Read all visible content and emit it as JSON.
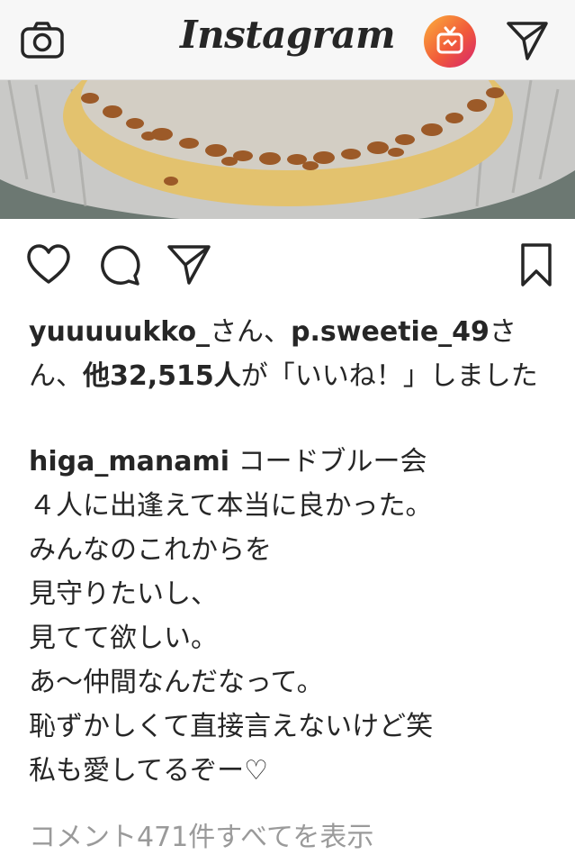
{
  "header": {
    "logo_text": "Instagram",
    "camera_icon": "camera-icon",
    "igtv_icon": "igtv-icon",
    "direct_icon": "paper-plane-icon",
    "igtv_gradient": [
      "#f9a23b",
      "#ee2a7b",
      "#d61e6b"
    ]
  },
  "post": {
    "actions": {
      "like_icon": "heart-icon",
      "comment_icon": "comment-icon",
      "share_icon": "paper-plane-icon",
      "save_icon": "bookmark-icon"
    },
    "likes": {
      "user1": "yuuuuukko_",
      "sep1": "さん、",
      "user2": "p.sweetie_49",
      "sep2": "さん、",
      "others": "他32,515人",
      "suffix": "が「いいね！」しました"
    },
    "caption": {
      "username": "higa_manami",
      "first_line": " コードブルー会",
      "lines": [
        "４人に出逢えて本当に良かった。",
        "みんなのこれからを",
        "見守りたいし、",
        "見てて欲しい。",
        "あ〜仲間なんだなって。",
        "恥ずかしくて直接言えないけど笑",
        "私も愛してるぞー♡"
      ]
    },
    "view_comments": "コメント471件すべてを表示"
  }
}
